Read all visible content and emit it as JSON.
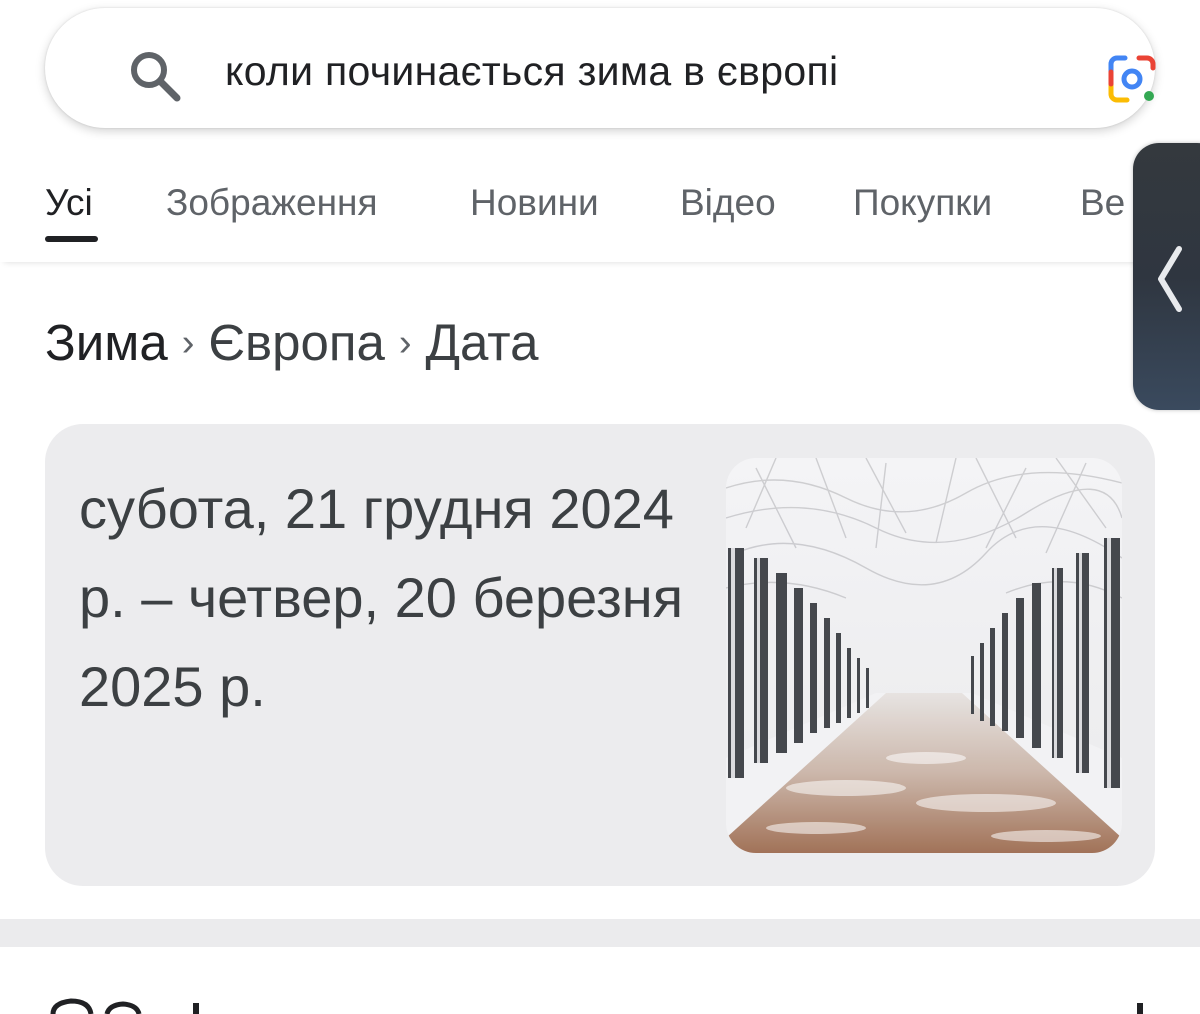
{
  "search": {
    "query": "коли починається зима в європі"
  },
  "tabs": [
    {
      "label": "Усі",
      "active": true
    },
    {
      "label": "Зображення",
      "active": false
    },
    {
      "label": "Новини",
      "active": false
    },
    {
      "label": "Відео",
      "active": false
    },
    {
      "label": "Покупки",
      "active": false
    },
    {
      "label": "Ве",
      "active": false
    }
  ],
  "breadcrumb": [
    "Зима",
    "Європа",
    "Дата"
  ],
  "answer": {
    "text": "субота, 21 грудня 2024 р. – четвер, 20 березня 2025 р."
  },
  "icons": {
    "search": "search-icon",
    "lens": "google-lens-icon",
    "side_handle": "chevron-left-icon"
  },
  "colors": {
    "text_primary": "#202124",
    "text_secondary": "#5f6368",
    "card_background": "#ececee",
    "lens_blue": "#4285f4",
    "lens_red": "#ea4335",
    "lens_yellow": "#fbbc04",
    "lens_green": "#34a853"
  }
}
